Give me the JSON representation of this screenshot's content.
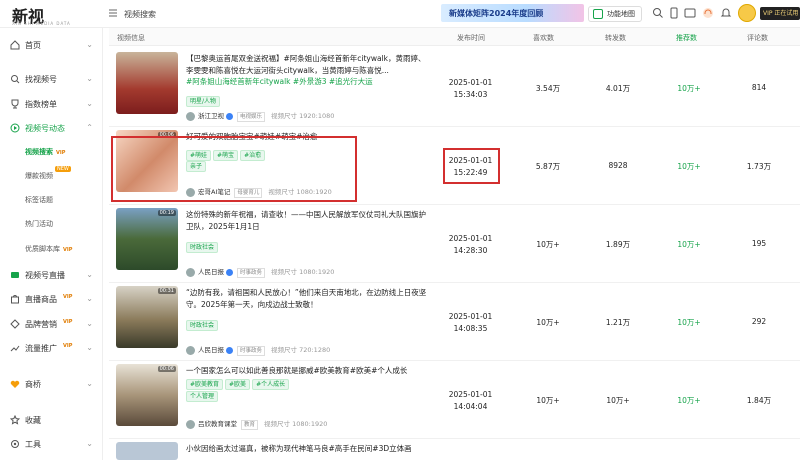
{
  "app": {
    "logo": "新视",
    "logo_sub": "XIN SHI MEDIA DATA"
  },
  "header": {
    "breadcrumb": "视频搜索",
    "banner_text": "新媒体矩阵2024年度回顾",
    "tool_btn": "功能地图",
    "vip": "VIP 正在试用"
  },
  "sidebar": {
    "items": [
      {
        "label": "首页",
        "icon": "home-icon",
        "chevron": "⌄"
      },
      {
        "label": "找视频号",
        "icon": "search-icon",
        "chevron": "⌄"
      },
      {
        "label": "指数榜单",
        "icon": "trophy-icon",
        "chevron": "⌄"
      },
      {
        "label": "视频号动态",
        "icon": "play-icon",
        "chevron": "⌃"
      }
    ],
    "subitems": [
      {
        "label": "视频搜索",
        "badge": "VIP"
      },
      {
        "label": "爆款视频",
        "badge": "NEW"
      },
      {
        "label": "标签话题",
        "badge": ""
      },
      {
        "label": "热门活动",
        "badge": ""
      },
      {
        "label": "优质脚本库",
        "badge": "VIP"
      }
    ],
    "items2": [
      {
        "label": "视频号直播",
        "icon": "live-icon",
        "chevron": "⌄",
        "badge": ""
      },
      {
        "label": "直播商品",
        "icon": "goods-icon",
        "chevron": "⌄",
        "badge": "VIP"
      },
      {
        "label": "品牌营销",
        "icon": "brand-icon",
        "chevron": "⌄",
        "badge": "VIP"
      },
      {
        "label": "流量推广",
        "icon": "traffic-icon",
        "chevron": "⌄",
        "badge": "VIP"
      },
      {
        "label": "商桥",
        "icon": "bridge-icon",
        "chevron": "⌄",
        "badge": ""
      },
      {
        "label": "收藏",
        "icon": "star-icon",
        "chevron": "",
        "badge": ""
      },
      {
        "label": "工具",
        "icon": "tool-icon",
        "chevron": "⌄",
        "badge": ""
      }
    ]
  },
  "table": {
    "headers": [
      "视频信息",
      "发布时间",
      "喜欢数",
      "转发数",
      "推荐数",
      "评论数"
    ],
    "rows": [
      {
        "title": "【巴黎奥运首尾双金送祝福】#阿条姐山海经首新年citywalk，黄雨婷、李雯雯和陈喜悦在大运河街头citywalk，当黄雨婷与陈喜悦...",
        "hashtags": "#阿条姐山海经首新年citywalk #外景游3 #追光行大运",
        "tags": [
          "明星/人物"
        ],
        "author": "浙江卫视",
        "category": "电视娱乐",
        "resolution": "视频尺寸 1920:1080",
        "date": "2025-01-01",
        "time": "15:34:03",
        "likes": "3.54万",
        "shares": "4.01万",
        "recs": "10万+",
        "comments": "814",
        "duration": ""
      },
      {
        "title": "好可爱的双胞胎宝宝#萌娃#萌宝#治愈",
        "hashtags": "",
        "tags": [
          "#萌娃",
          "#萌宝",
          "#治愈",
          "亲子"
        ],
        "author": "宏哥AI笔记",
        "category": "母婴育儿",
        "resolution": "视频尺寸 1080:1920",
        "date": "2025-01-01",
        "time": "15:22:49",
        "likes": "5.87万",
        "shares": "8928",
        "recs": "10万+",
        "comments": "1.73万",
        "duration": "00:06"
      },
      {
        "title": "这份特殊的新年祝福，请查收！——中国人民解放军仪仗司礼大队国旗护卫队，2025年1月1日",
        "hashtags": "",
        "tags": [
          "时政社会"
        ],
        "author": "人民日报",
        "category": "时事政务",
        "resolution": "视频尺寸 1080:1920",
        "date": "2025-01-01",
        "time": "14:28:30",
        "likes": "10万+",
        "shares": "1.89万",
        "recs": "10万+",
        "comments": "195",
        "duration": "00:19"
      },
      {
        "title": "“边防有我，请祖国和人民放心！”他们来自天南地北，在边防线上日夜坚守。2025年第一天，向戍边战士致敬！",
        "hashtags": "",
        "tags": [
          "时政社会"
        ],
        "author": "人民日报",
        "category": "时事政务",
        "resolution": "视频尺寸 720:1280",
        "date": "2025-01-01",
        "time": "14:08:35",
        "likes": "10万+",
        "shares": "1.21万",
        "recs": "10万+",
        "comments": "292",
        "duration": "00:31"
      },
      {
        "title": "一个国家怎么可以如此善良那就是挪威#欧美教育#欧美#个人成长",
        "hashtags": "",
        "tags": [
          "#欧美教育",
          "#欧美",
          "#个人成长",
          "个人管理"
        ],
        "author": "吕欣教育课堂",
        "category": "教育",
        "resolution": "视频尺寸 1080:1920",
        "date": "2025-01-01",
        "time": "14:04:04",
        "likes": "10万+",
        "shares": "10万+",
        "recs": "10万+",
        "comments": "1.84万",
        "duration": "00:06"
      },
      {
        "title": "小伙因给画太过逼真，被称为现代神笔马良#高手在民间#3D立体画",
        "hashtags": "",
        "tags": [],
        "author": "",
        "category": "",
        "resolution": "",
        "date": "",
        "time": "",
        "likes": "",
        "shares": "",
        "recs": "",
        "comments": "",
        "duration": ""
      }
    ]
  }
}
